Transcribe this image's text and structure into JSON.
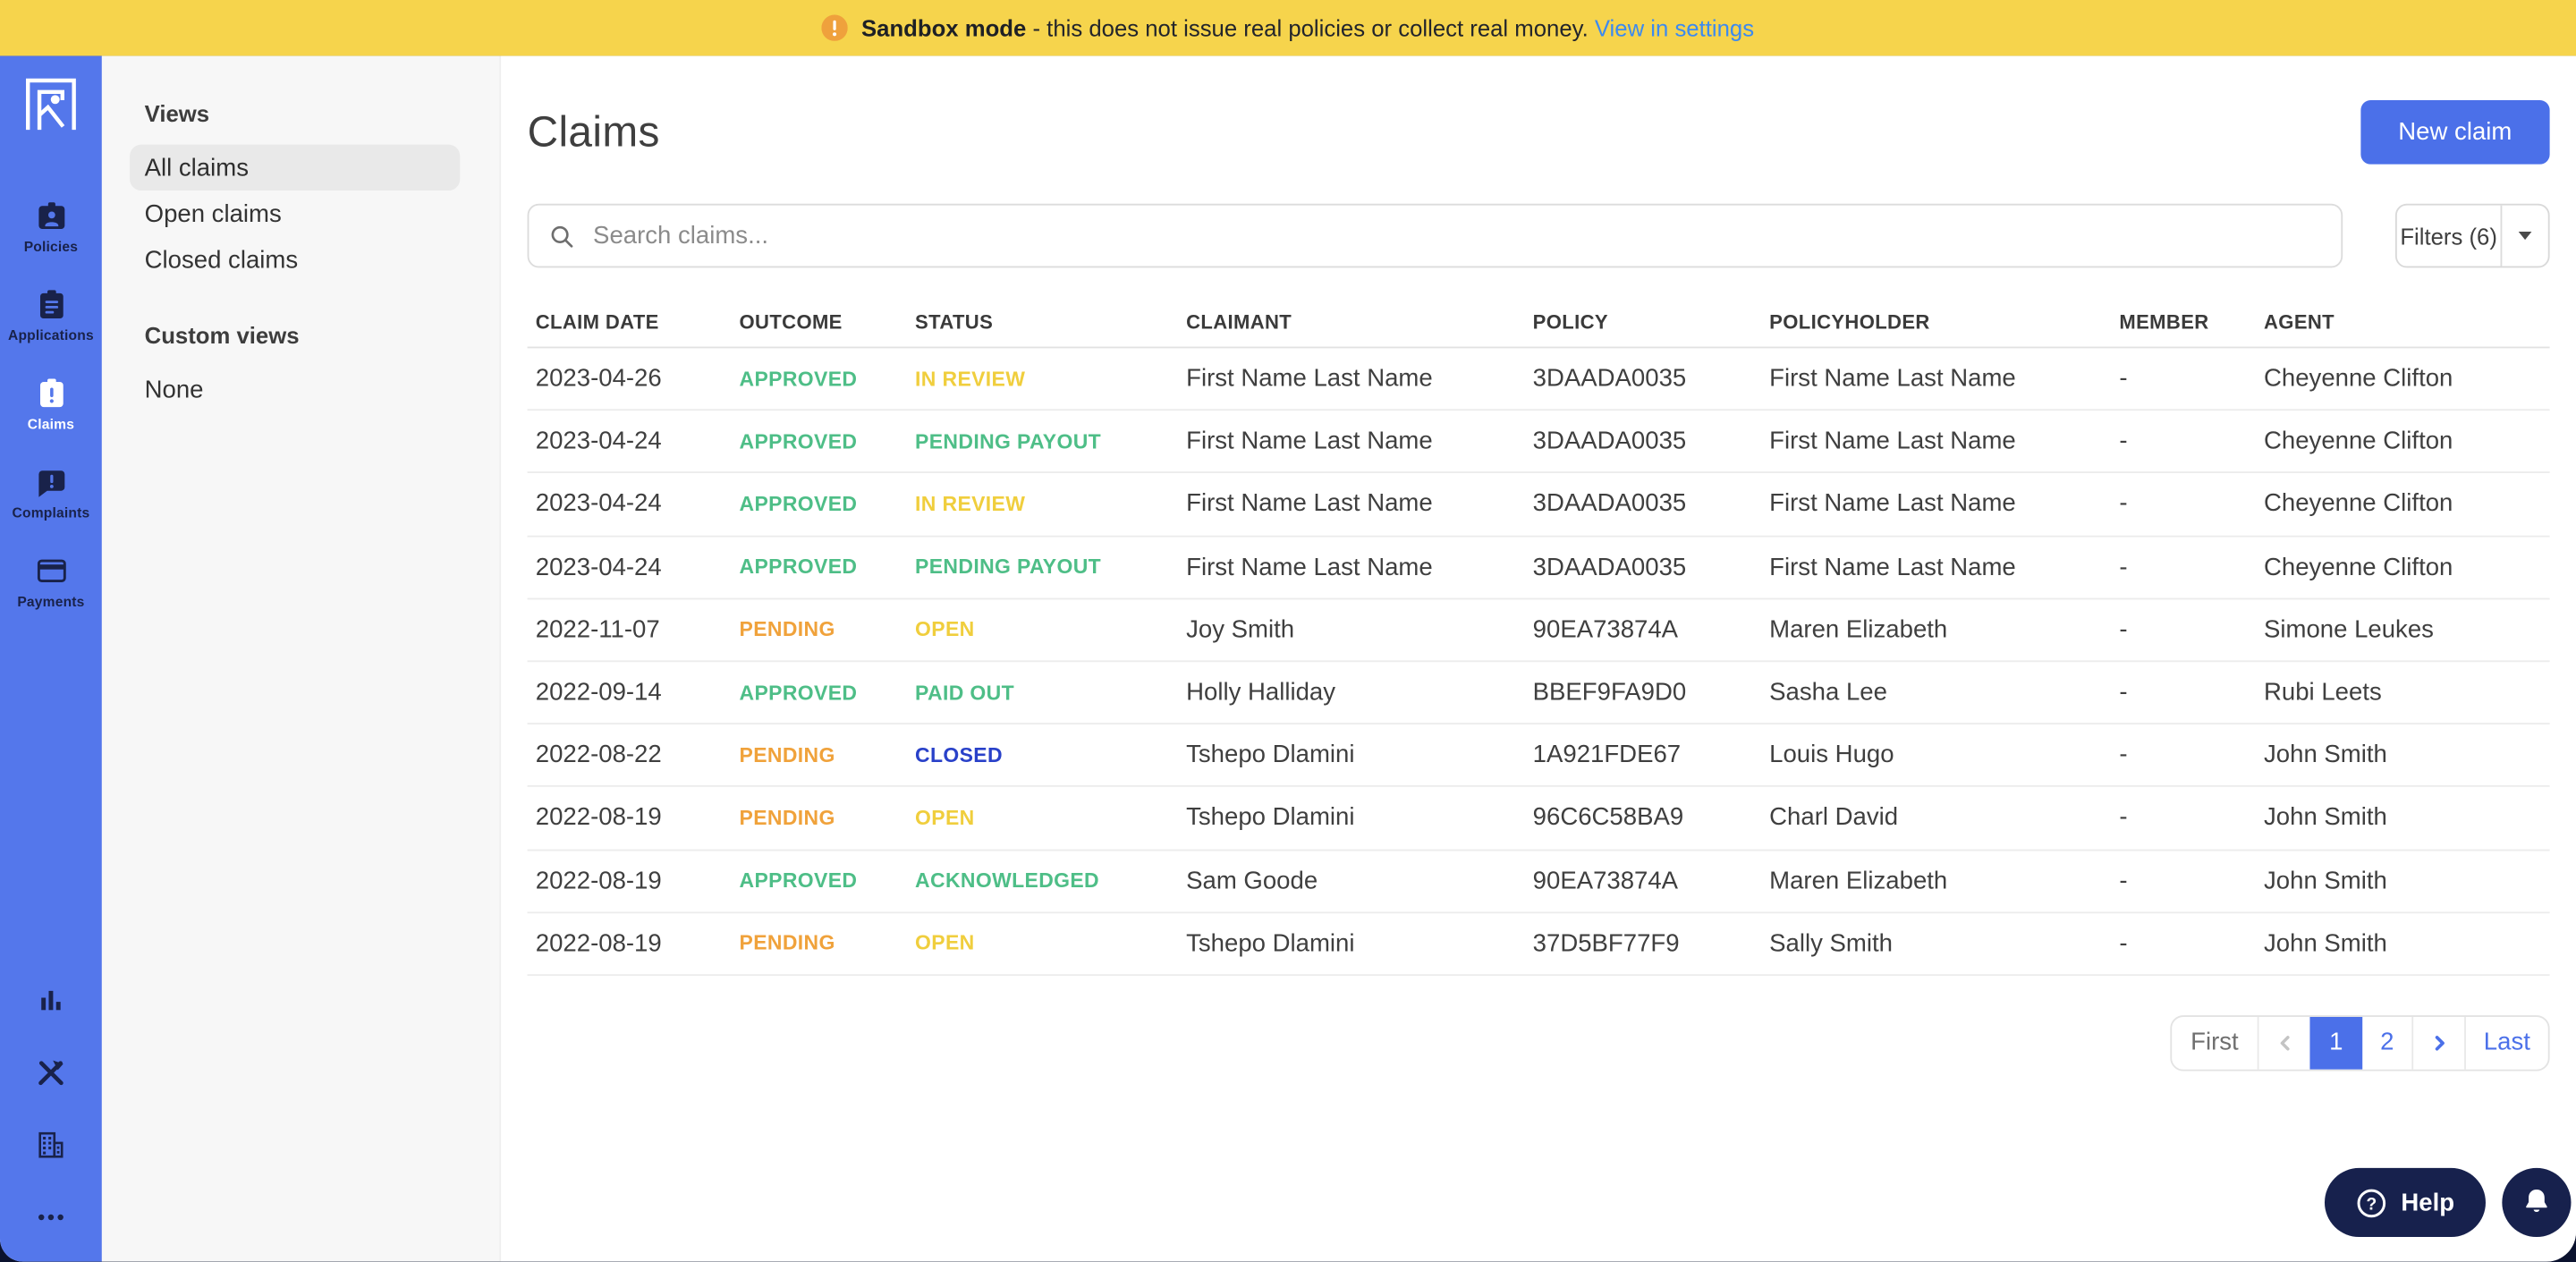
{
  "banner": {
    "icon": "warning-icon",
    "bold": "Sandbox mode",
    "message": " - this does not issue real policies or collect real money. ",
    "link": "View in settings"
  },
  "colors": {
    "accent_blue": "#4B70E9",
    "rail_blue": "#5477EB",
    "banner_yellow": "#F6D44C",
    "navy": "#17214D",
    "green": "#4EBE87",
    "yellow": "#F0CE3D",
    "orange": "#F0A23B",
    "closed_blue": "#2941C9"
  },
  "nav_rail": {
    "logo": "root-logo",
    "items": [
      {
        "label": "Policies",
        "icon": "policies-icon",
        "active": false
      },
      {
        "label": "Applications",
        "icon": "applications-icon",
        "active": false
      },
      {
        "label": "Claims",
        "icon": "claims-icon",
        "active": true
      },
      {
        "label": "Complaints",
        "icon": "complaints-icon",
        "active": false
      },
      {
        "label": "Payments",
        "icon": "payments-icon",
        "active": false
      }
    ],
    "footer_icons": [
      "bar-chart-icon",
      "tools-icon",
      "building-icon",
      "more-icon"
    ]
  },
  "views_panel": {
    "heading": "Views",
    "items": [
      {
        "label": "All claims",
        "selected": true
      },
      {
        "label": "Open claims",
        "selected": false
      },
      {
        "label": "Closed claims",
        "selected": false
      }
    ],
    "custom_heading": "Custom views",
    "custom_items": [
      {
        "label": "None"
      }
    ]
  },
  "header": {
    "title": "Claims",
    "new_claim_label": "New claim"
  },
  "toolbar": {
    "search_placeholder": "Search claims...",
    "filters_label": "Filters (6)"
  },
  "table": {
    "columns": [
      "CLAIM DATE",
      "OUTCOME",
      "STATUS",
      "CLAIMANT",
      "POLICY",
      "POLICYHOLDER",
      "MEMBER",
      "AGENT"
    ],
    "rows": [
      {
        "claim_date": "2023-04-26",
        "outcome": "APPROVED",
        "outcome_color": "#4EBE87",
        "status": "IN REVIEW",
        "status_color": "#F0CE3D",
        "claimant": "First Name Last Name",
        "policy": "3DAADA0035",
        "policyholder": "First Name Last Name",
        "member": "-",
        "agent": "Cheyenne Clifton"
      },
      {
        "claim_date": "2023-04-24",
        "outcome": "APPROVED",
        "outcome_color": "#4EBE87",
        "status": "PENDING PAYOUT",
        "status_color": "#4EBE87",
        "claimant": "First Name Last Name",
        "policy": "3DAADA0035",
        "policyholder": "First Name Last Name",
        "member": "-",
        "agent": "Cheyenne Clifton"
      },
      {
        "claim_date": "2023-04-24",
        "outcome": "APPROVED",
        "outcome_color": "#4EBE87",
        "status": "IN REVIEW",
        "status_color": "#F0CE3D",
        "claimant": "First Name Last Name",
        "policy": "3DAADA0035",
        "policyholder": "First Name Last Name",
        "member": "-",
        "agent": "Cheyenne Clifton"
      },
      {
        "claim_date": "2023-04-24",
        "outcome": "APPROVED",
        "outcome_color": "#4EBE87",
        "status": "PENDING PAYOUT",
        "status_color": "#4EBE87",
        "claimant": "First Name Last Name",
        "policy": "3DAADA0035",
        "policyholder": "First Name Last Name",
        "member": "-",
        "agent": "Cheyenne Clifton"
      },
      {
        "claim_date": "2022-11-07",
        "outcome": "PENDING",
        "outcome_color": "#F0A23B",
        "status": "OPEN",
        "status_color": "#F0CE3D",
        "claimant": "Joy Smith",
        "policy": "90EA73874A",
        "policyholder": "Maren Elizabeth",
        "member": "-",
        "agent": "Simone Leukes"
      },
      {
        "claim_date": "2022-09-14",
        "outcome": "APPROVED",
        "outcome_color": "#4EBE87",
        "status": "PAID OUT",
        "status_color": "#4EBE87",
        "claimant": "Holly Halliday",
        "policy": "BBEF9FA9D0",
        "policyholder": "Sasha Lee",
        "member": "-",
        "agent": "Rubi Leets"
      },
      {
        "claim_date": "2022-08-22",
        "outcome": "PENDING",
        "outcome_color": "#F0A23B",
        "status": "CLOSED",
        "status_color": "#2941C9",
        "claimant": "Tshepo Dlamini",
        "policy": "1A921FDE67",
        "policyholder": "Louis Hugo",
        "member": "-",
        "agent": "John Smith"
      },
      {
        "claim_date": "2022-08-19",
        "outcome": "PENDING",
        "outcome_color": "#F0A23B",
        "status": "OPEN",
        "status_color": "#F0CE3D",
        "claimant": "Tshepo Dlamini",
        "policy": "96C6C58BA9",
        "policyholder": "Charl David",
        "member": "-",
        "agent": "John Smith"
      },
      {
        "claim_date": "2022-08-19",
        "outcome": "APPROVED",
        "outcome_color": "#4EBE87",
        "status": "ACKNOWLEDGED",
        "status_color": "#4EBE87",
        "claimant": "Sam Goode",
        "policy": "90EA73874A",
        "policyholder": "Maren Elizabeth",
        "member": "-",
        "agent": "John Smith"
      },
      {
        "claim_date": "2022-08-19",
        "outcome": "PENDING",
        "outcome_color": "#F0A23B",
        "status": "OPEN",
        "status_color": "#F0CE3D",
        "claimant": "Tshepo Dlamini",
        "policy": "37D5BF77F9",
        "policyholder": "Sally Smith",
        "member": "-",
        "agent": "John Smith"
      }
    ]
  },
  "pagination": {
    "first": "First",
    "prev_icon": "chevron-left-icon",
    "pages": [
      "1",
      "2"
    ],
    "current": "1",
    "next_icon": "chevron-right-icon",
    "last": "Last"
  },
  "help": {
    "icon": "question-circle-icon",
    "label": "Help"
  },
  "notifications": {
    "icon": "bell-icon"
  }
}
